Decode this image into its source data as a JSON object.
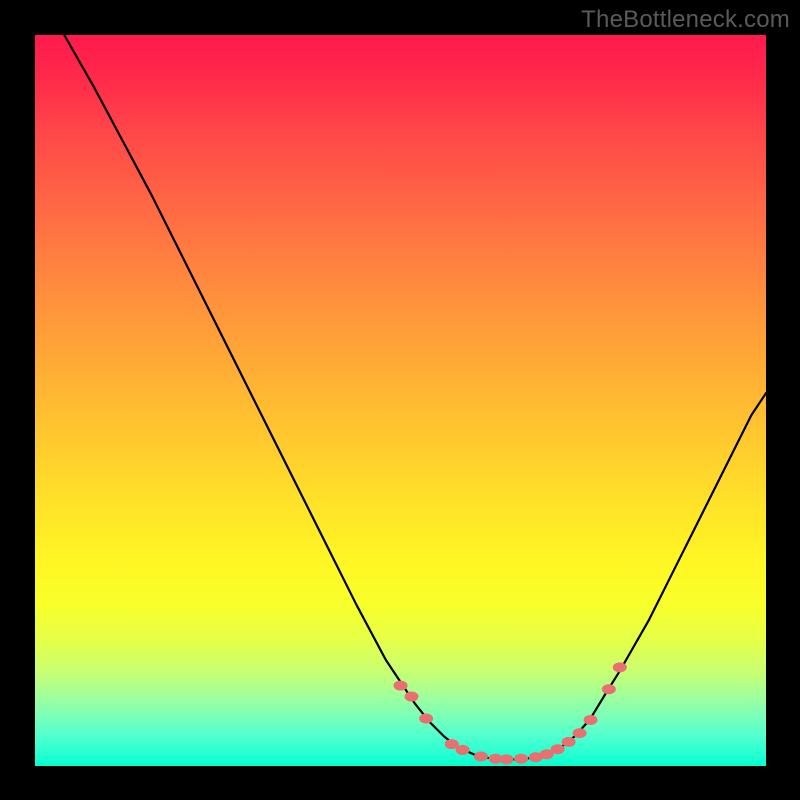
{
  "watermark": "TheBottleneck.com",
  "chart_data": {
    "type": "line",
    "title": "",
    "xlabel": "",
    "ylabel": "",
    "xlim": [
      0,
      100
    ],
    "ylim": [
      0,
      100
    ],
    "grid": false,
    "curve": [
      {
        "x": 4.0,
        "y": 100.0
      },
      {
        "x": 8.0,
        "y": 93.0
      },
      {
        "x": 12.0,
        "y": 85.5
      },
      {
        "x": 16.0,
        "y": 78.0
      },
      {
        "x": 20.0,
        "y": 70.0
      },
      {
        "x": 24.0,
        "y": 62.0
      },
      {
        "x": 28.0,
        "y": 54.0
      },
      {
        "x": 32.0,
        "y": 46.0
      },
      {
        "x": 36.0,
        "y": 38.0
      },
      {
        "x": 40.0,
        "y": 30.0
      },
      {
        "x": 44.0,
        "y": 22.0
      },
      {
        "x": 48.0,
        "y": 14.5
      },
      {
        "x": 52.0,
        "y": 8.5
      },
      {
        "x": 54.0,
        "y": 6.0
      },
      {
        "x": 56.0,
        "y": 4.0
      },
      {
        "x": 58.0,
        "y": 2.5
      },
      {
        "x": 60.0,
        "y": 1.6
      },
      {
        "x": 62.0,
        "y": 1.1
      },
      {
        "x": 64.0,
        "y": 0.9
      },
      {
        "x": 66.0,
        "y": 0.9
      },
      {
        "x": 68.0,
        "y": 1.1
      },
      {
        "x": 70.0,
        "y": 1.6
      },
      {
        "x": 72.0,
        "y": 2.6
      },
      {
        "x": 74.0,
        "y": 4.2
      },
      {
        "x": 76.0,
        "y": 6.5
      },
      {
        "x": 78.0,
        "y": 9.8
      },
      {
        "x": 80.0,
        "y": 13.0
      },
      {
        "x": 82.0,
        "y": 16.5
      },
      {
        "x": 84.0,
        "y": 20.0
      },
      {
        "x": 86.0,
        "y": 24.0
      },
      {
        "x": 88.0,
        "y": 28.0
      },
      {
        "x": 90.0,
        "y": 32.0
      },
      {
        "x": 92.0,
        "y": 36.0
      },
      {
        "x": 94.0,
        "y": 40.0
      },
      {
        "x": 96.0,
        "y": 44.0
      },
      {
        "x": 98.0,
        "y": 48.0
      },
      {
        "x": 100.0,
        "y": 51.0
      }
    ],
    "markers": [
      {
        "x": 50.0,
        "y": 11.0
      },
      {
        "x": 51.5,
        "y": 9.5
      },
      {
        "x": 53.5,
        "y": 6.5
      },
      {
        "x": 57.0,
        "y": 3.0
      },
      {
        "x": 58.5,
        "y": 2.2
      },
      {
        "x": 61.0,
        "y": 1.3
      },
      {
        "x": 63.0,
        "y": 1.0
      },
      {
        "x": 64.5,
        "y": 0.9
      },
      {
        "x": 66.5,
        "y": 1.0
      },
      {
        "x": 68.5,
        "y": 1.2
      },
      {
        "x": 70.0,
        "y": 1.6
      },
      {
        "x": 71.5,
        "y": 2.3
      },
      {
        "x": 73.0,
        "y": 3.3
      },
      {
        "x": 74.5,
        "y": 4.5
      },
      {
        "x": 76.0,
        "y": 6.3
      },
      {
        "x": 78.5,
        "y": 10.5
      },
      {
        "x": 80.0,
        "y": 13.5
      }
    ],
    "marker_color": "#e87070",
    "curve_color": "#000000"
  }
}
